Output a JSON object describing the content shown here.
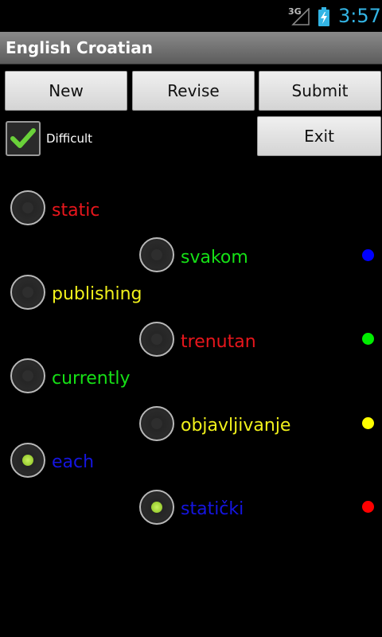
{
  "status": {
    "network": "3G",
    "time": "3:57",
    "time_color": "#33b5e5"
  },
  "app": {
    "title": "English Croatian"
  },
  "toolbar": {
    "new_label": "New",
    "revise_label": "Revise",
    "submit_label": "Submit",
    "exit_label": "Exit"
  },
  "options": {
    "difficult_label": "Difficult",
    "difficult_checked": true
  },
  "english_words": [
    {
      "text": "static",
      "color": "#e8161c",
      "checked": false
    },
    {
      "text": "publishing",
      "color": "#f2f21b",
      "checked": false
    },
    {
      "text": "currently",
      "color": "#16e016",
      "checked": false
    },
    {
      "text": "each",
      "color": "#1515e0",
      "checked": true
    }
  ],
  "croatian_words": [
    {
      "text": "svakom",
      "color": "#16e016",
      "checked": false,
      "marker_color": "#0000ff"
    },
    {
      "text": "trenutan",
      "color": "#e8161c",
      "checked": false,
      "marker_color": "#00ee00"
    },
    {
      "text": "objavljivanje",
      "color": "#f2f21b",
      "checked": false,
      "marker_color": "#ffff00"
    },
    {
      "text": "statički",
      "color": "#1515e0",
      "checked": true,
      "marker_color": "#ff0000"
    }
  ]
}
